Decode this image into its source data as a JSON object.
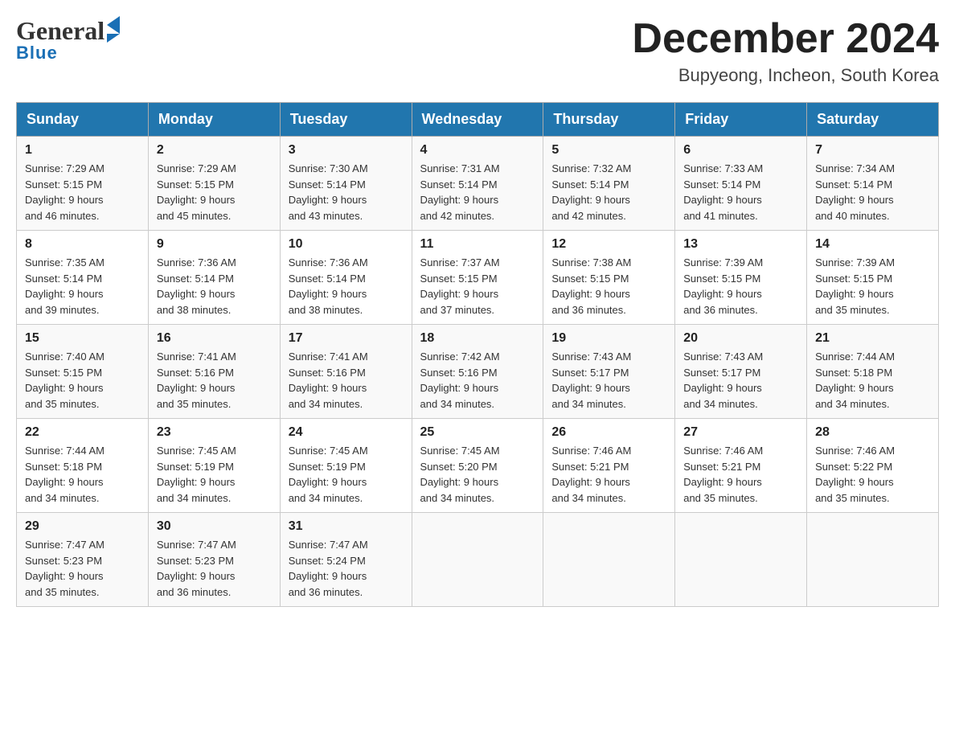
{
  "header": {
    "logo_general": "General",
    "logo_blue": "Blue",
    "month_title": "December 2024",
    "location": "Bupyeong, Incheon, South Korea"
  },
  "days_of_week": [
    "Sunday",
    "Monday",
    "Tuesday",
    "Wednesday",
    "Thursday",
    "Friday",
    "Saturday"
  ],
  "weeks": [
    [
      {
        "day": "1",
        "sunrise": "7:29 AM",
        "sunset": "5:15 PM",
        "daylight": "9 hours and 46 minutes."
      },
      {
        "day": "2",
        "sunrise": "7:29 AM",
        "sunset": "5:15 PM",
        "daylight": "9 hours and 45 minutes."
      },
      {
        "day": "3",
        "sunrise": "7:30 AM",
        "sunset": "5:14 PM",
        "daylight": "9 hours and 43 minutes."
      },
      {
        "day": "4",
        "sunrise": "7:31 AM",
        "sunset": "5:14 PM",
        "daylight": "9 hours and 42 minutes."
      },
      {
        "day": "5",
        "sunrise": "7:32 AM",
        "sunset": "5:14 PM",
        "daylight": "9 hours and 42 minutes."
      },
      {
        "day": "6",
        "sunrise": "7:33 AM",
        "sunset": "5:14 PM",
        "daylight": "9 hours and 41 minutes."
      },
      {
        "day": "7",
        "sunrise": "7:34 AM",
        "sunset": "5:14 PM",
        "daylight": "9 hours and 40 minutes."
      }
    ],
    [
      {
        "day": "8",
        "sunrise": "7:35 AM",
        "sunset": "5:14 PM",
        "daylight": "9 hours and 39 minutes."
      },
      {
        "day": "9",
        "sunrise": "7:36 AM",
        "sunset": "5:14 PM",
        "daylight": "9 hours and 38 minutes."
      },
      {
        "day": "10",
        "sunrise": "7:36 AM",
        "sunset": "5:14 PM",
        "daylight": "9 hours and 38 minutes."
      },
      {
        "day": "11",
        "sunrise": "7:37 AM",
        "sunset": "5:15 PM",
        "daylight": "9 hours and 37 minutes."
      },
      {
        "day": "12",
        "sunrise": "7:38 AM",
        "sunset": "5:15 PM",
        "daylight": "9 hours and 36 minutes."
      },
      {
        "day": "13",
        "sunrise": "7:39 AM",
        "sunset": "5:15 PM",
        "daylight": "9 hours and 36 minutes."
      },
      {
        "day": "14",
        "sunrise": "7:39 AM",
        "sunset": "5:15 PM",
        "daylight": "9 hours and 35 minutes."
      }
    ],
    [
      {
        "day": "15",
        "sunrise": "7:40 AM",
        "sunset": "5:15 PM",
        "daylight": "9 hours and 35 minutes."
      },
      {
        "day": "16",
        "sunrise": "7:41 AM",
        "sunset": "5:16 PM",
        "daylight": "9 hours and 35 minutes."
      },
      {
        "day": "17",
        "sunrise": "7:41 AM",
        "sunset": "5:16 PM",
        "daylight": "9 hours and 34 minutes."
      },
      {
        "day": "18",
        "sunrise": "7:42 AM",
        "sunset": "5:16 PM",
        "daylight": "9 hours and 34 minutes."
      },
      {
        "day": "19",
        "sunrise": "7:43 AM",
        "sunset": "5:17 PM",
        "daylight": "9 hours and 34 minutes."
      },
      {
        "day": "20",
        "sunrise": "7:43 AM",
        "sunset": "5:17 PM",
        "daylight": "9 hours and 34 minutes."
      },
      {
        "day": "21",
        "sunrise": "7:44 AM",
        "sunset": "5:18 PM",
        "daylight": "9 hours and 34 minutes."
      }
    ],
    [
      {
        "day": "22",
        "sunrise": "7:44 AM",
        "sunset": "5:18 PM",
        "daylight": "9 hours and 34 minutes."
      },
      {
        "day": "23",
        "sunrise": "7:45 AM",
        "sunset": "5:19 PM",
        "daylight": "9 hours and 34 minutes."
      },
      {
        "day": "24",
        "sunrise": "7:45 AM",
        "sunset": "5:19 PM",
        "daylight": "9 hours and 34 minutes."
      },
      {
        "day": "25",
        "sunrise": "7:45 AM",
        "sunset": "5:20 PM",
        "daylight": "9 hours and 34 minutes."
      },
      {
        "day": "26",
        "sunrise": "7:46 AM",
        "sunset": "5:21 PM",
        "daylight": "9 hours and 34 minutes."
      },
      {
        "day": "27",
        "sunrise": "7:46 AM",
        "sunset": "5:21 PM",
        "daylight": "9 hours and 35 minutes."
      },
      {
        "day": "28",
        "sunrise": "7:46 AM",
        "sunset": "5:22 PM",
        "daylight": "9 hours and 35 minutes."
      }
    ],
    [
      {
        "day": "29",
        "sunrise": "7:47 AM",
        "sunset": "5:23 PM",
        "daylight": "9 hours and 35 minutes."
      },
      {
        "day": "30",
        "sunrise": "7:47 AM",
        "sunset": "5:23 PM",
        "daylight": "9 hours and 36 minutes."
      },
      {
        "day": "31",
        "sunrise": "7:47 AM",
        "sunset": "5:24 PM",
        "daylight": "9 hours and 36 minutes."
      },
      null,
      null,
      null,
      null
    ]
  ],
  "labels": {
    "sunrise": "Sunrise:",
    "sunset": "Sunset:",
    "daylight": "Daylight:"
  }
}
